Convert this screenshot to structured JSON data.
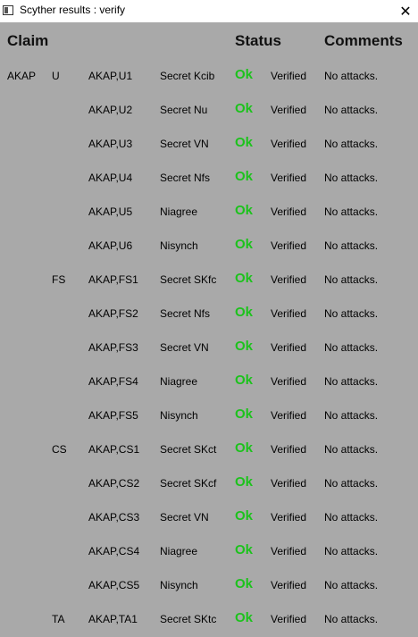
{
  "window": {
    "title": "Scyther results : verify",
    "close_glyph": "✕"
  },
  "header": {
    "claim": "Claim",
    "status": "Status",
    "comments": "Comments"
  },
  "colors": {
    "background": "#a9a9a9",
    "ok": "#1cc21c"
  },
  "rows": [
    {
      "protocol": "AKAP",
      "role": "U",
      "id": "AKAP,U1",
      "claim": "Secret Kcib",
      "status": "Ok",
      "verification": "Verified",
      "comment": "No attacks."
    },
    {
      "protocol": "",
      "role": "",
      "id": "AKAP,U2",
      "claim": "Secret Nu",
      "status": "Ok",
      "verification": "Verified",
      "comment": "No attacks."
    },
    {
      "protocol": "",
      "role": "",
      "id": "AKAP,U3",
      "claim": "Secret VN",
      "status": "Ok",
      "verification": "Verified",
      "comment": "No attacks."
    },
    {
      "protocol": "",
      "role": "",
      "id": "AKAP,U4",
      "claim": "Secret Nfs",
      "status": "Ok",
      "verification": "Verified",
      "comment": "No attacks."
    },
    {
      "protocol": "",
      "role": "",
      "id": "AKAP,U5",
      "claim": "Niagree",
      "status": "Ok",
      "verification": "Verified",
      "comment": "No attacks."
    },
    {
      "protocol": "",
      "role": "",
      "id": "AKAP,U6",
      "claim": "Nisynch",
      "status": "Ok",
      "verification": "Verified",
      "comment": "No attacks."
    },
    {
      "protocol": "",
      "role": "FS",
      "id": "AKAP,FS1",
      "claim": "Secret SKfc",
      "status": "Ok",
      "verification": "Verified",
      "comment": "No attacks."
    },
    {
      "protocol": "",
      "role": "",
      "id": "AKAP,FS2",
      "claim": "Secret Nfs",
      "status": "Ok",
      "verification": "Verified",
      "comment": "No attacks."
    },
    {
      "protocol": "",
      "role": "",
      "id": "AKAP,FS3",
      "claim": "Secret VN",
      "status": "Ok",
      "verification": "Verified",
      "comment": "No attacks."
    },
    {
      "protocol": "",
      "role": "",
      "id": "AKAP,FS4",
      "claim": "Niagree",
      "status": "Ok",
      "verification": "Verified",
      "comment": "No attacks."
    },
    {
      "protocol": "",
      "role": "",
      "id": "AKAP,FS5",
      "claim": "Nisynch",
      "status": "Ok",
      "verification": "Verified",
      "comment": "No attacks."
    },
    {
      "protocol": "",
      "role": "CS",
      "id": "AKAP,CS1",
      "claim": "Secret SKct",
      "status": "Ok",
      "verification": "Verified",
      "comment": "No attacks."
    },
    {
      "protocol": "",
      "role": "",
      "id": "AKAP,CS2",
      "claim": "Secret SKcf",
      "status": "Ok",
      "verification": "Verified",
      "comment": "No attacks."
    },
    {
      "protocol": "",
      "role": "",
      "id": "AKAP,CS3",
      "claim": "Secret VN",
      "status": "Ok",
      "verification": "Verified",
      "comment": "No attacks."
    },
    {
      "protocol": "",
      "role": "",
      "id": "AKAP,CS4",
      "claim": "Niagree",
      "status": "Ok",
      "verification": "Verified",
      "comment": "No attacks."
    },
    {
      "protocol": "",
      "role": "",
      "id": "AKAP,CS5",
      "claim": "Nisynch",
      "status": "Ok",
      "verification": "Verified",
      "comment": "No attacks."
    },
    {
      "protocol": "",
      "role": "TA",
      "id": "AKAP,TA1",
      "claim": "Secret SKtc",
      "status": "Ok",
      "verification": "Verified",
      "comment": "No attacks."
    }
  ]
}
